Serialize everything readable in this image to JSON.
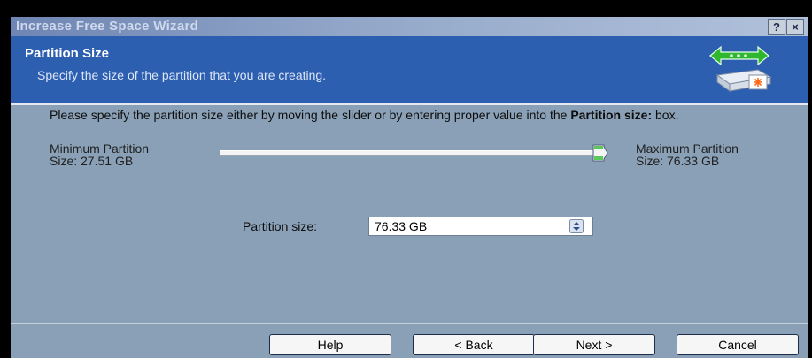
{
  "window": {
    "title": "Increase Free Space Wizard",
    "help_button": "?",
    "close_button": "×"
  },
  "header": {
    "title": "Partition Size",
    "subtitle": "Specify the size of the partition that you are creating."
  },
  "body": {
    "instruction_prefix": "Please specify the partition size either by moving the slider or by entering proper value into the ",
    "instruction_bold": "Partition size:",
    "instruction_suffix": " box.",
    "min_label": "Minimum Partition",
    "min_value": "Size: 27.51 GB",
    "max_label": "Maximum Partition",
    "max_value": "Size: 76.33 GB",
    "slider_value_gb": 76.33,
    "slider_min_gb": 27.51,
    "slider_max_gb": 76.33,
    "partition_size_label": "Partition size:",
    "partition_size_value": "76.33 GB"
  },
  "footer": {
    "help": "Help",
    "back": "< Back",
    "next": "Next >",
    "cancel": "Cancel"
  },
  "icons": {
    "header_icon": "disk-arrows-icon",
    "slider_thumb": "slider-thumb-icon",
    "spinner": "spinner-icon"
  },
  "colors": {
    "header_bg": "#2d5fb1",
    "body_bg": "#8aa0b6",
    "arrow_green": "#2fb82f"
  }
}
